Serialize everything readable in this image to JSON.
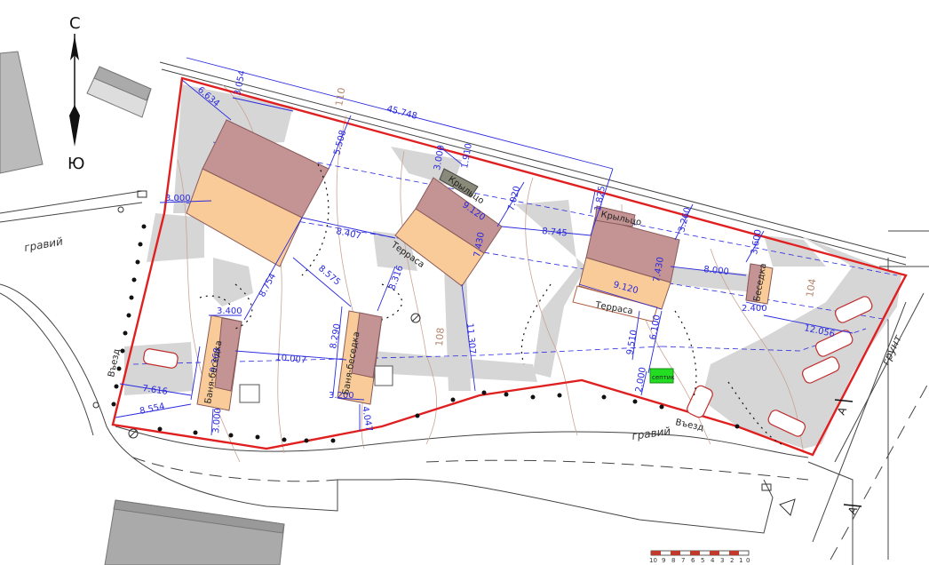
{
  "compass": {
    "north": "С",
    "south": "Ю"
  },
  "roads": {
    "gravel_left": "гравий",
    "gravel_bottom": "гравий",
    "ground_right": "грунт"
  },
  "entrances": {
    "left": "Въезд",
    "bottom": "Въезд"
  },
  "section_marks": {
    "top": "А",
    "bottom": "А"
  },
  "contours": {
    "c110": "110",
    "c108": "108",
    "c104": "104"
  },
  "labels": {
    "krylco_1": "Крыльцо",
    "krylco_2": "Крыльцо",
    "terrasa_1": "Терраса",
    "terrasa_2": "Терраса",
    "banya_1": "Баня-беседка",
    "banya_2": "Баня-беседка",
    "besedka": "Беседка",
    "septic": "септик"
  },
  "dimensions": {
    "d45748": "45.748",
    "d6634": "6.634",
    "d3054": "3.054",
    "d5508": "5.508",
    "d3000a": "3.000",
    "d3000b": "3.000",
    "d1910": "1.910",
    "d9120a": "9.120",
    "d7020": "7.020",
    "d1825": "1.825",
    "d3260": "3.260",
    "d3600": "3.600",
    "d7430a": "7.430",
    "d7430b": "7.430",
    "d8407": "8.407",
    "d8745": "8.745",
    "d8000": "8.000",
    "d2400": "2.400",
    "d8575": "8.575",
    "d8316": "8.316",
    "d9120b": "9.120",
    "d12056": "12.056",
    "d8754": "8.754",
    "d3400": "3.400",
    "d9368": "9.368",
    "d7616": "7.616",
    "d10007": "10.007",
    "d8290": "8.290",
    "d3200": "3.200",
    "d4047": "4.047",
    "d11307": "11.307",
    "d9510": "9.510",
    "d6100": "6.100",
    "d2000": "2.000",
    "d3000c": "3.000",
    "d8554": "8.554"
  },
  "scale_bar": {
    "ticks": [
      "10",
      "9",
      "8",
      "7",
      "6",
      "5",
      "4",
      "3",
      "2",
      "1",
      "0"
    ]
  },
  "colors": {
    "boundary": "#e02020",
    "roof_dark": "#c49494",
    "roof_light": "#f8cb98",
    "paving": "#d6d6d6",
    "dimension": "#2a2adf",
    "septic": "#22dd22"
  }
}
